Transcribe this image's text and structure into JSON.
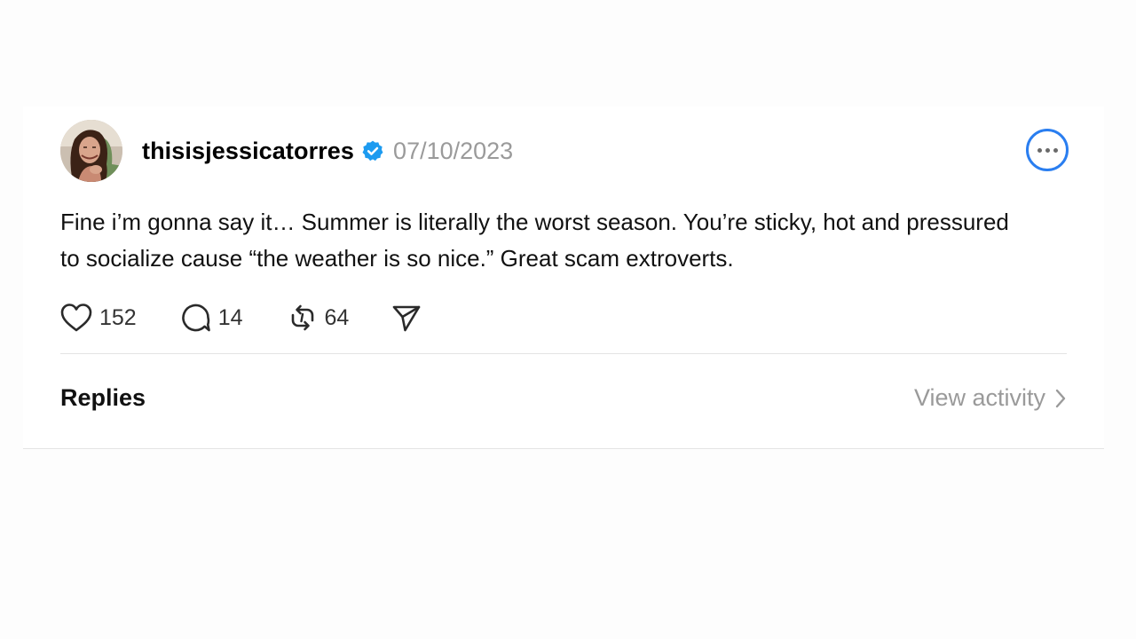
{
  "post": {
    "username": "thisisjessicatorres",
    "timestamp": "07/10/2023",
    "verified": true,
    "body": "Fine i’m gonna say it… Summer is literally the worst season. You’re sticky, hot and pressured to socialize cause “the weather is so nice.” Great scam extroverts.",
    "actions": {
      "likes": "152",
      "replies": "14",
      "reposts": "64"
    },
    "icons": {
      "like": "heart-icon",
      "reply": "speech-bubble-icon",
      "repost": "repost-icon",
      "share": "send-icon",
      "more": "more-options-icon",
      "verified": "verified-badge-icon"
    }
  },
  "replies_section": {
    "heading": "Replies",
    "view_activity_label": "View activity"
  },
  "colors": {
    "verified_badge": "#1d9bf0",
    "focus_ring": "#2a7ef0",
    "secondary_text": "#9a9a9a"
  }
}
